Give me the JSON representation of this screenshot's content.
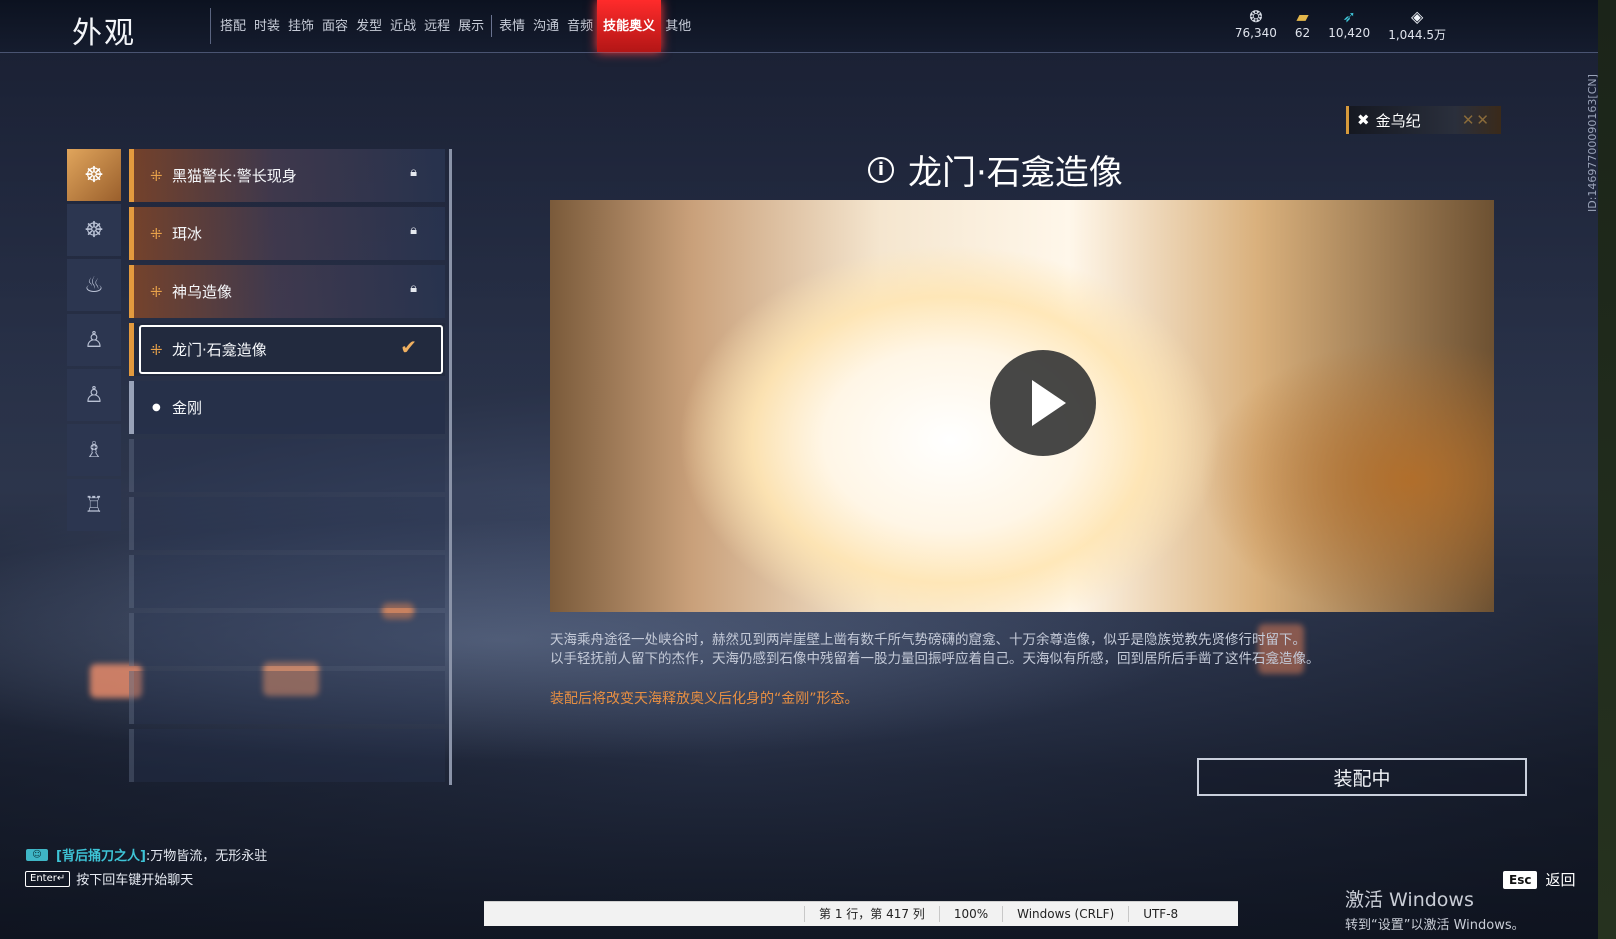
{
  "header": {
    "title": "外观",
    "tabs": [
      {
        "label": "搭配"
      },
      {
        "label": "时装"
      },
      {
        "label": "挂饰"
      },
      {
        "label": "面容"
      },
      {
        "label": "发型"
      },
      {
        "label": "近战"
      },
      {
        "label": "远程"
      },
      {
        "label": "展示"
      },
      {
        "label": "表情"
      },
      {
        "label": "沟通"
      },
      {
        "label": "音频"
      },
      {
        "label": "技能奥义"
      },
      {
        "label": "其他"
      }
    ],
    "active_tab": "技能奥义",
    "currencies": [
      {
        "icon": "silver-coin-icon",
        "value": "76,340"
      },
      {
        "icon": "gold-ingot-icon",
        "value": "62"
      },
      {
        "icon": "feather-icon",
        "value": "10,420"
      },
      {
        "icon": "diamond-icon",
        "value": "1,044.5万"
      }
    ]
  },
  "side_id": "ID:1469770009016​3[CN]",
  "badge": {
    "label": "金乌纪"
  },
  "categories": [
    {
      "icon": "avatar-pose-1-icon",
      "active": true
    },
    {
      "icon": "avatar-pose-2-icon"
    },
    {
      "icon": "avatar-pose-3-icon"
    },
    {
      "icon": "avatar-pose-4-icon"
    },
    {
      "icon": "avatar-pose-5-icon"
    },
    {
      "icon": "avatar-pose-6-icon"
    },
    {
      "icon": "avatar-pose-7-icon"
    }
  ],
  "skins": [
    {
      "name": "黑猫警长·警长现身",
      "state": "locked"
    },
    {
      "name": "珥冰",
      "state": "locked"
    },
    {
      "name": "神乌造像",
      "state": "locked"
    },
    {
      "name": "龙门·石龛造像",
      "state": "selected"
    },
    {
      "name": "金刚",
      "state": "default"
    }
  ],
  "detail": {
    "title": "龙门·石龛造像",
    "description_line1": "天海乘舟途径一处峡谷时，赫然见到两岸崖壁上凿有数千所气势磅礴的窟龛、十万余尊造像，似乎是隐族觉教先贤修行时留下。",
    "description_line2": "以手轻抚前人留下的杰作，天海仍感到石像中残留着一股力量回振呼应着自己。天海似有所感，回到居所后手凿了这件石龛造像。",
    "note": "装配后将改变天海释放奥义后化身的“金刚”形态。",
    "equip_button": "装配中"
  },
  "chat": {
    "channel": "[背后捅刀之人]",
    "message": ":万物皆流，无形永驻",
    "enter_key": "Enter↵",
    "hint": "按下回车键开始聊天"
  },
  "esc": {
    "key": "Esc",
    "label": "返回"
  },
  "statusbar": {
    "position": "第 1 行，第 417 列",
    "zoom": "100%",
    "eol": "Windows (CRLF)",
    "encoding": "UTF-8"
  },
  "watermark": {
    "line1": "激活 Windows",
    "line2": "转到“设置”以激活 Windows。"
  }
}
